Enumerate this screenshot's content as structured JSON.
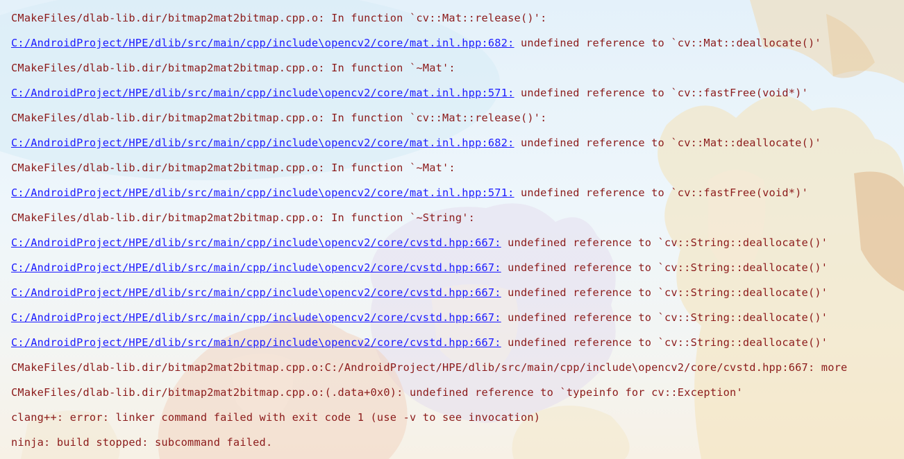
{
  "colors": {
    "text": "#8b1a1a",
    "link": "#1a1aff",
    "background": "#e8f3fa"
  },
  "console": {
    "lines": [
      {
        "text": "CMakeFiles/dlab-lib.dir/bitmap2mat2bitmap.cpp.o: In function `cv::Mat::release()':"
      },
      {
        "link": "C:/AndroidProject/HPE/dlib/src/main/cpp/include\\opencv2/core/mat.inl.hpp:682:",
        "message": " undefined reference to `cv::Mat::deallocate()'"
      },
      {
        "text": "CMakeFiles/dlab-lib.dir/bitmap2mat2bitmap.cpp.o: In function `~Mat':"
      },
      {
        "link": "C:/AndroidProject/HPE/dlib/src/main/cpp/include\\opencv2/core/mat.inl.hpp:571:",
        "message": " undefined reference to `cv::fastFree(void*)'"
      },
      {
        "text": "CMakeFiles/dlab-lib.dir/bitmap2mat2bitmap.cpp.o: In function `cv::Mat::release()':"
      },
      {
        "link": "C:/AndroidProject/HPE/dlib/src/main/cpp/include\\opencv2/core/mat.inl.hpp:682:",
        "message": " undefined reference to `cv::Mat::deallocate()'"
      },
      {
        "text": "CMakeFiles/dlab-lib.dir/bitmap2mat2bitmap.cpp.o: In function `~Mat':"
      },
      {
        "link": "C:/AndroidProject/HPE/dlib/src/main/cpp/include\\opencv2/core/mat.inl.hpp:571:",
        "message": " undefined reference to `cv::fastFree(void*)'"
      },
      {
        "text": "CMakeFiles/dlab-lib.dir/bitmap2mat2bitmap.cpp.o: In function `~String':"
      },
      {
        "link": "C:/AndroidProject/HPE/dlib/src/main/cpp/include\\opencv2/core/cvstd.hpp:667:",
        "message": " undefined reference to `cv::String::deallocate()'"
      },
      {
        "link": "C:/AndroidProject/HPE/dlib/src/main/cpp/include\\opencv2/core/cvstd.hpp:667:",
        "message": " undefined reference to `cv::String::deallocate()'"
      },
      {
        "link": "C:/AndroidProject/HPE/dlib/src/main/cpp/include\\opencv2/core/cvstd.hpp:667:",
        "message": " undefined reference to `cv::String::deallocate()'"
      },
      {
        "link": "C:/AndroidProject/HPE/dlib/src/main/cpp/include\\opencv2/core/cvstd.hpp:667:",
        "message": " undefined reference to `cv::String::deallocate()'"
      },
      {
        "link": "C:/AndroidProject/HPE/dlib/src/main/cpp/include\\opencv2/core/cvstd.hpp:667:",
        "message": " undefined reference to `cv::String::deallocate()'"
      },
      {
        "text": "CMakeFiles/dlab-lib.dir/bitmap2mat2bitmap.cpp.o:C:/AndroidProject/HPE/dlib/src/main/cpp/include\\opencv2/core/cvstd.hpp:667: more"
      },
      {
        "text": "CMakeFiles/dlab-lib.dir/bitmap2mat2bitmap.cpp.o:(.data+0x0): undefined reference to `typeinfo for cv::Exception'"
      },
      {
        "text": "clang++: error: linker command failed with exit code 1 (use -v to see invocation)"
      },
      {
        "text": "ninja: build stopped: subcommand failed."
      }
    ]
  }
}
